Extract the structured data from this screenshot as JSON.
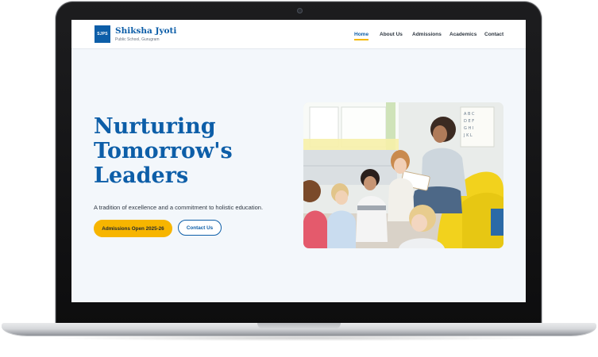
{
  "brand": {
    "logo_text": "SJPS",
    "name": "Shiksha Jyoti",
    "tagline": "Public School, Gurugram"
  },
  "nav": {
    "items": [
      {
        "label": "Home",
        "active": true
      },
      {
        "label": "About Us",
        "active": false
      },
      {
        "label": "Admissions",
        "active": false
      },
      {
        "label": "Academics",
        "active": false
      },
      {
        "label": "Contact",
        "active": false
      }
    ]
  },
  "hero": {
    "title_lines": [
      "Nurturing",
      "Tomorrow's",
      "Leaders"
    ],
    "subtitle": "A tradition of excellence and a commitment to holistic education.",
    "primary_cta": "Admissions Open 2025-26",
    "secondary_cta": "Contact Us",
    "image_icon": "classroom-photo"
  },
  "colors": {
    "brand_blue": "#0d5ea8",
    "accent_yellow": "#f7b500",
    "page_background": "#f3f7fb"
  }
}
